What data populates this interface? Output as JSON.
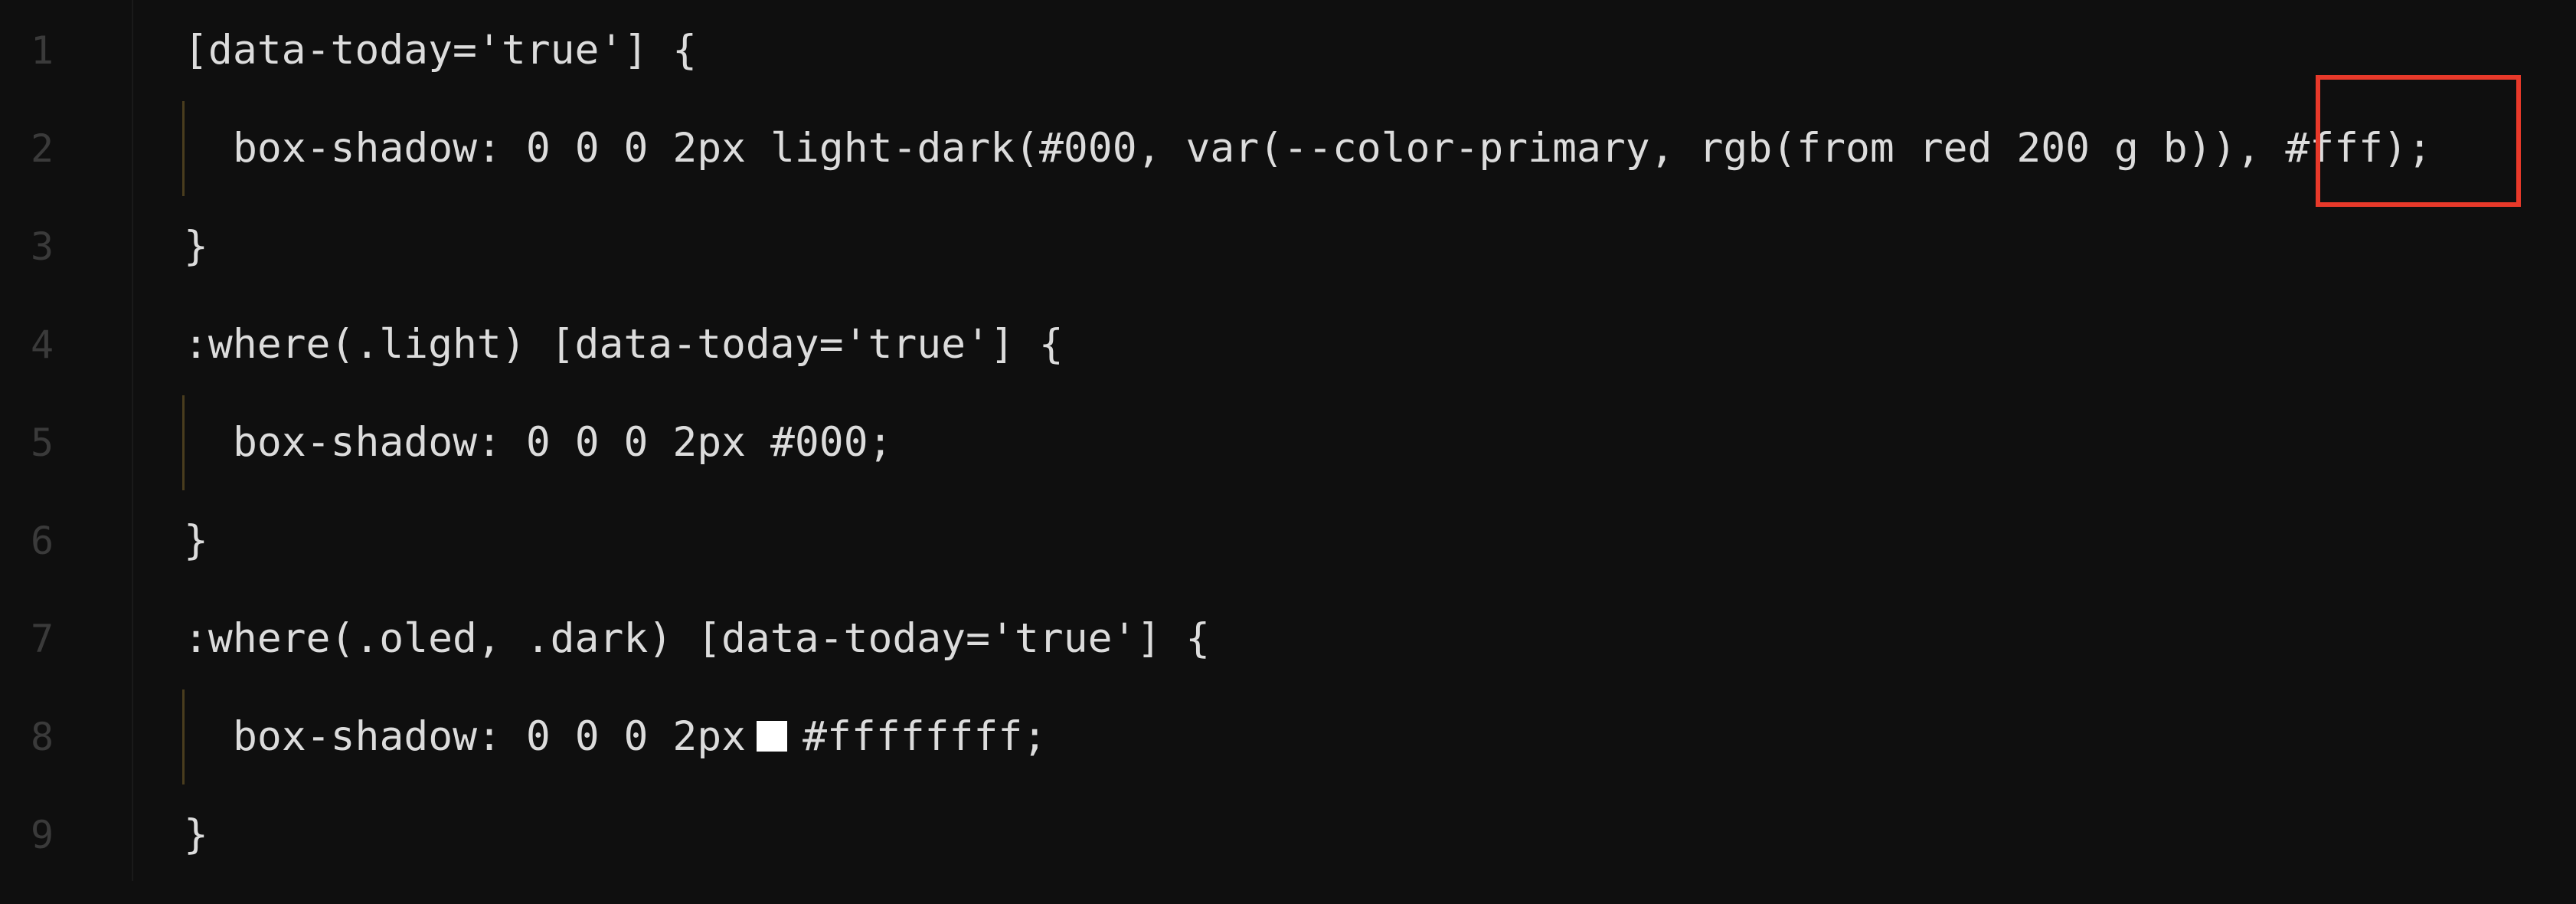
{
  "editor": {
    "line_numbers": [
      "1",
      "2",
      "3",
      "4",
      "5",
      "6",
      "7",
      "8",
      "9"
    ],
    "lines": {
      "l1": "[data-today='true'] {",
      "l2": "box-shadow: 0 0 0 2px light-dark(#000, var(--color-primary, rgb(from red 200 g b)), #fff);",
      "l3": "}",
      "l4": ":where(.light) [data-today='true'] {",
      "l5": "box-shadow: 0 0 0 2px #000;",
      "l6": "}",
      "l7": ":where(.oled, .dark) [data-today='true'] {",
      "l8_before": "box-shadow: 0 0 0 2px",
      "l8_after": "#ffffffff;",
      "l9": "}"
    },
    "swatch_color": "#ffffff",
    "highlight_color": "#e8392a"
  }
}
